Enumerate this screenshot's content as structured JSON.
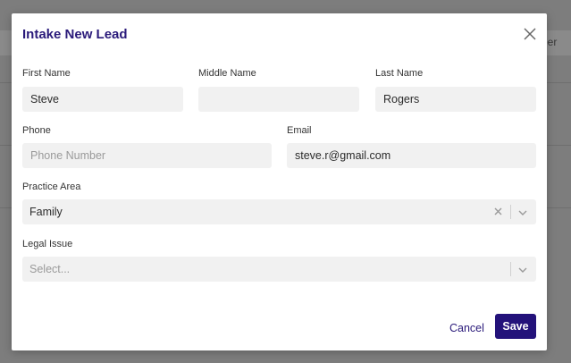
{
  "background": {
    "partial_text": "mber"
  },
  "modal": {
    "title": "Intake New Lead",
    "fields": {
      "first_name": {
        "label": "First Name",
        "value": "Steve",
        "placeholder": ""
      },
      "middle_name": {
        "label": "Middle Name",
        "value": "",
        "placeholder": ""
      },
      "last_name": {
        "label": "Last Name",
        "value": "Rogers",
        "placeholder": ""
      },
      "phone": {
        "label": "Phone",
        "value": "",
        "placeholder": "Phone Number"
      },
      "email": {
        "label": "Email",
        "value": "steve.r@gmail.com",
        "placeholder": ""
      },
      "practice_area": {
        "label": "Practice Area",
        "selected": "Family"
      },
      "legal_issue": {
        "label": "Legal Issue",
        "selected": "",
        "placeholder": "Select..."
      }
    },
    "buttons": {
      "cancel": "Cancel",
      "save": "Save"
    }
  },
  "icons": {
    "close": "close-icon",
    "clear": "clear-x-icon",
    "chevron": "chevron-down-icon"
  },
  "colors": {
    "primary": "#23127a",
    "title": "#2a1a7a",
    "field_bg": "#f1f1f1",
    "overlay": "#7d7d7d"
  }
}
